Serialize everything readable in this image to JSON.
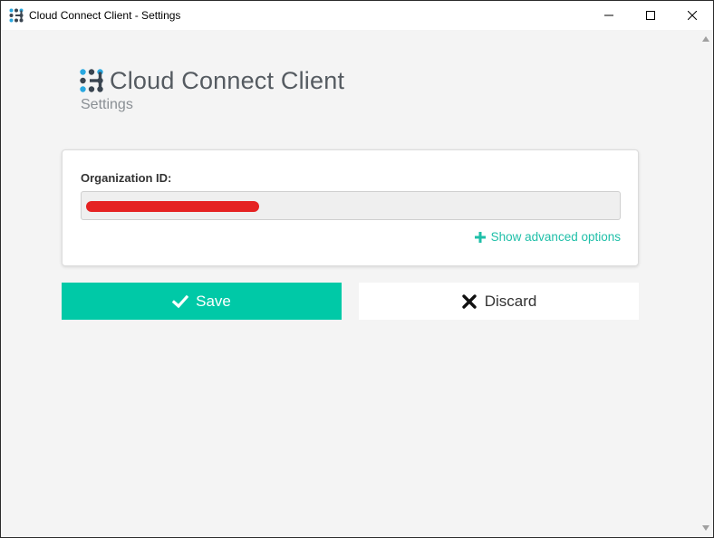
{
  "window": {
    "title": "Cloud Connect Client - Settings",
    "icons": {
      "app": "app-logo-icon",
      "minimize": "minimize-icon",
      "maximize": "maximize-icon",
      "close": "close-icon"
    }
  },
  "header": {
    "app_name": "Cloud Connect Client",
    "subtitle": "Settings"
  },
  "form": {
    "org_id_label": "Organization ID:",
    "org_id_value": "",
    "advanced_link": "Show advanced options"
  },
  "actions": {
    "save_label": "Save",
    "discard_label": "Discard"
  },
  "colors": {
    "accent": "#00c9a7",
    "link": "#1fbfa8",
    "logo_dark": "#3a4550",
    "logo_blue": "#29a8e0",
    "redaction": "#e52222"
  }
}
